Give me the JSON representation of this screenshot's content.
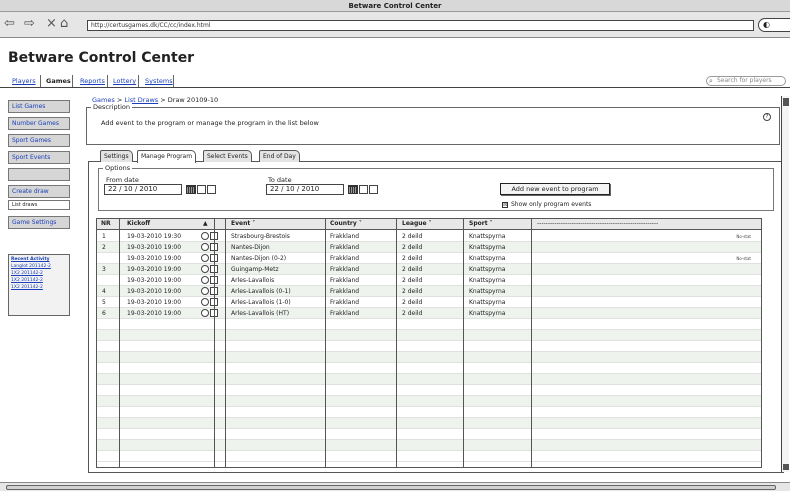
{
  "window": {
    "title": "Betware Control Center"
  },
  "browser": {
    "back": "⇦",
    "forward": "⇨",
    "close": "×",
    "home": "⌂",
    "url": "http://certusgames.dk/CC/cc/index.html",
    "search_glyph": "◐"
  },
  "app": {
    "title": "Betware Control Center"
  },
  "topnav": {
    "items": [
      "Players",
      "Games",
      "Reports",
      "Lottery",
      "Systems"
    ],
    "search_placeholder": "Search for players"
  },
  "sidebar": {
    "items": [
      "List Games",
      "Number Games",
      "Sport Games",
      "Sport Events",
      "",
      "Create draw",
      "List draws",
      "Game Settings"
    ],
    "recent": {
      "title": "Recent Activity",
      "items": [
        "Langlot 201142-2",
        "1X2 201142-2",
        "1X2 201142-2",
        "1X2 201142-2"
      ]
    }
  },
  "breadcrumb": {
    "games": "Games",
    "sep1": ">",
    "list_draws": "List Draws",
    "sep2": ">",
    "current": "Draw 20109-10"
  },
  "description": {
    "label": "Description",
    "text": "Add event to the program or manage the program in the list below",
    "help": "?"
  },
  "tabs": [
    "Settings",
    "Manage Program",
    "Select Events",
    "End of Day"
  ],
  "options": {
    "label": "Options",
    "from_label": "From date",
    "from_value": "22 / 10 / 2010",
    "to_label": "To date",
    "to_value": "22 / 10 / 2010",
    "add_button": "Add new event to program",
    "checkbox_mark": "☒",
    "checkbox_label": "Show only program events"
  },
  "table": {
    "headers": [
      "NR",
      "Kickoff",
      "▲",
      "Event ˅",
      "Country ˅",
      "League ˅",
      "Sport ˅",
      "--------------------------------------------------------"
    ],
    "rows": [
      {
        "nr": "1",
        "kickoff": "19-03-2010 19:30",
        "event": "Strasbourg-Brestois",
        "country": "Frakkland",
        "league": "2 deild",
        "sport": "Knattspyrna",
        "status": "No-stat"
      },
      {
        "nr": "2",
        "kickoff": "19-03-2010 19:00",
        "event": "Nantes-Dijon",
        "country": "Frakkland",
        "league": "2 deild",
        "sport": "Knattspyrna",
        "status": ""
      },
      {
        "nr": "",
        "kickoff": "19-03-2010 19:00",
        "event": "Nantes-Dijon (0-2)",
        "country": "Frakkland",
        "league": "2 deild",
        "sport": "Knattspyrna",
        "status": "No-stat"
      },
      {
        "nr": "3",
        "kickoff": "19-03-2010 19:00",
        "event": "Guingamp-Metz",
        "country": "Frakkland",
        "league": "2 deild",
        "sport": "Knattspyrna",
        "status": ""
      },
      {
        "nr": "",
        "kickoff": "19-03-2010 19:00",
        "event": "Arles-Lavallois",
        "country": "Frakkland",
        "league": "2 deild",
        "sport": "Knattspyrna",
        "status": ""
      },
      {
        "nr": "4",
        "kickoff": "19-03-2010 19:00",
        "event": "Arles-Lavallois (0-1)",
        "country": "Frakkland",
        "league": "2 deild",
        "sport": "Knattspyrna",
        "status": ""
      },
      {
        "nr": "5",
        "kickoff": "19-03-2010 19:00",
        "event": "Arles-Lavallois (1-0)",
        "country": "Frakkland",
        "league": "2 deild",
        "sport": "Knattspyrna",
        "status": ""
      },
      {
        "nr": "6",
        "kickoff": "19-03-2010 19:00",
        "event": "Arles-Lavallois (HT)",
        "country": "Frakkland",
        "league": "2 deild",
        "sport": "Knattspyrna",
        "status": ""
      }
    ],
    "empty_rows": 13
  }
}
